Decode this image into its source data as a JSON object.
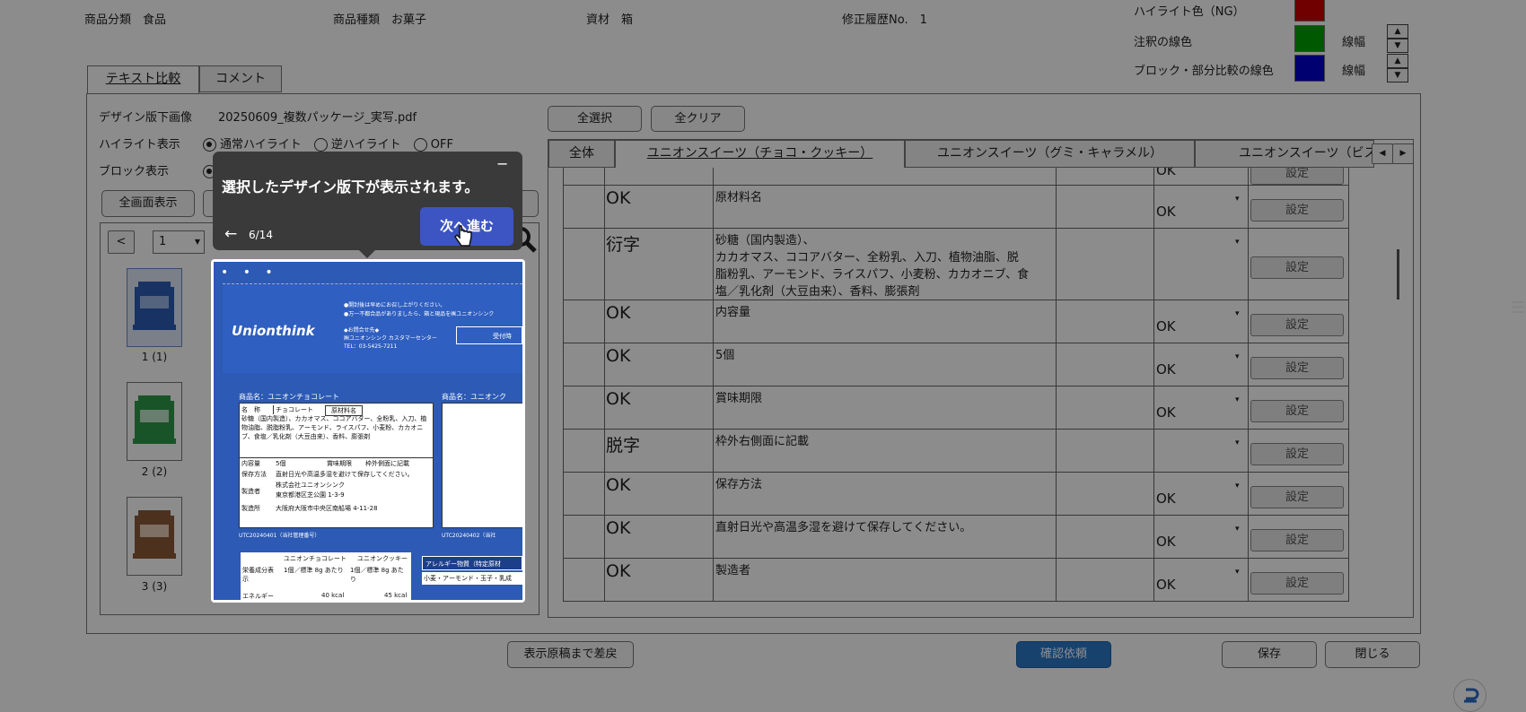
{
  "header": {
    "category_label": "商品分類　食品",
    "type_label": "商品種類　お菓子",
    "material_label": "資材　箱",
    "revision_label": "修正履歴No.　1",
    "highlight_color_label": "ハイライト色（NG）",
    "note_line_label": "注釈の線色",
    "block_line_label": "ブロック・部分比較の線色",
    "line_width_label_1": "線幅",
    "line_width_label_2": "線幅",
    "colors": {
      "highlight_ng": "#cc0000",
      "note_line": "#00a000",
      "block_line": "#0000cc"
    }
  },
  "tabs": {
    "text_compare": "テキスト比較",
    "comment": "コメント"
  },
  "design": {
    "image_label": "デザイン版下画像",
    "image_file": "20250609_複数パッケージ_実写.pdf",
    "highlight_label": "ハイライト表示",
    "highlight_options": [
      "通常ハイライト",
      "逆ハイライト",
      "OFF"
    ],
    "block_label": "ブロック表示",
    "fullscreen_button": "全画面表示",
    "page_prev": "<",
    "page_value": "1",
    "thumbnails": [
      "1 (1)",
      "2 (2)",
      "3 (3)"
    ]
  },
  "actions": {
    "select_all": "全選択",
    "clear_all": "全クリア"
  },
  "product_tabs": [
    "全体",
    "ユニオンスイーツ（チョコ・クッキー）",
    "ユニオンスイーツ（グミ・キャラメル）",
    "ユニオンスイーツ（ビスケ"
  ],
  "table": {
    "rows": [
      {
        "status": "",
        "text": "",
        "result": "OK",
        "button": "設定"
      },
      {
        "status": "OK",
        "text": "原材料名",
        "result": "OK",
        "button": "設定"
      },
      {
        "status": "衍字",
        "text": "砂糖（国内製造）、\nカカオマス、ココアバター、全粉乳、入刀、植物油脂、脱\n脂粉乳、アーモンド、ライスパフ、小麦粉、カカオニブ、食\n塩／乳化剤（大豆由来）、香料、膨張剤",
        "result": "",
        "button": "設定"
      },
      {
        "status": "OK",
        "text": "内容量",
        "result": "OK",
        "button": "設定"
      },
      {
        "status": "OK",
        "text": "5個",
        "result": "OK",
        "button": "設定"
      },
      {
        "status": "OK",
        "text": "賞味期限",
        "result": "OK",
        "button": "設定"
      },
      {
        "status": "脱字",
        "text": "枠外右側面に記載",
        "result": "",
        "button": "設定"
      },
      {
        "status": "OK",
        "text": "保存方法",
        "result": "OK",
        "button": "設定"
      },
      {
        "status": "OK",
        "text": "直射日光や高温多湿を避けて保存してください。",
        "result": "OK",
        "button": "設定"
      },
      {
        "status": "OK",
        "text": "製造者",
        "result": "OK",
        "button": "設定"
      }
    ]
  },
  "footer": {
    "revert": "表示原稿まで差戻",
    "request": "確認依頼",
    "save": "保存",
    "close": "閉じる"
  },
  "tour": {
    "message": "選択したデザイン版下が表示されます。",
    "minimize": "−",
    "back": "←",
    "progress": "6/14",
    "next": "次へ進む"
  },
  "preview": {
    "brand": "Unionthink",
    "product_name_1": "商品名：ユニオンチョコレート",
    "product_name_2": "商品名：ユニオンク",
    "name_header": "名　称",
    "name_value": "チョコレート",
    "ingredients_header": "原材料名",
    "ingredients_value": "砂糖（国内製造）、カカオマス、ココアバター、全粉乳、入刀、植物油脂、脱脂粉乳、アーモンド、ライスパフ、小麦粉、カカオニブ、食塩／乳化剤（大豆由来）、香料、膨張剤",
    "content_header": "内容量",
    "content_value": "5個",
    "expiry_header": "賞味期限",
    "expiry_value": "枠外側面に記載",
    "storage_header": "保存方法",
    "storage_value": "直射日光や高温多湿を避けて保存してください。",
    "maker_header": "製造者",
    "maker_value": "株式会社ユニオンシンク\n東京都港区芝公園 1-3-9",
    "factory_header": "製造所",
    "factory_value": "大阪府大阪市中央区南船場 4-11-28",
    "code": "UTC20240401（当社管理番号）",
    "code_2": "UTC20240402（当社",
    "contact": "◆お問合せ先◆\n㈱ユニオンシンク カスタマーセンター\nTEL：03-5425-7211",
    "notice": "●開封後は早めにお召し上がりください。\n●万一不都合品がありましたら、箱と現品を㈱ユニオンシンク",
    "hours": "受付時",
    "allergy": "アレルギー物質（特定原材",
    "allergy_list": "小麦・アーモンド・玉子・乳成",
    "nutrition_col1": "ユニオンチョコレート",
    "nutrition_col2": "ユニオンクッキー",
    "nutrition_row1": "栄養成分表示",
    "nutrition_per": "1個／標準 8g あたり",
    "energy": "エネルギー",
    "energy_1": "40 kcal",
    "energy_2": "45 kcal"
  }
}
